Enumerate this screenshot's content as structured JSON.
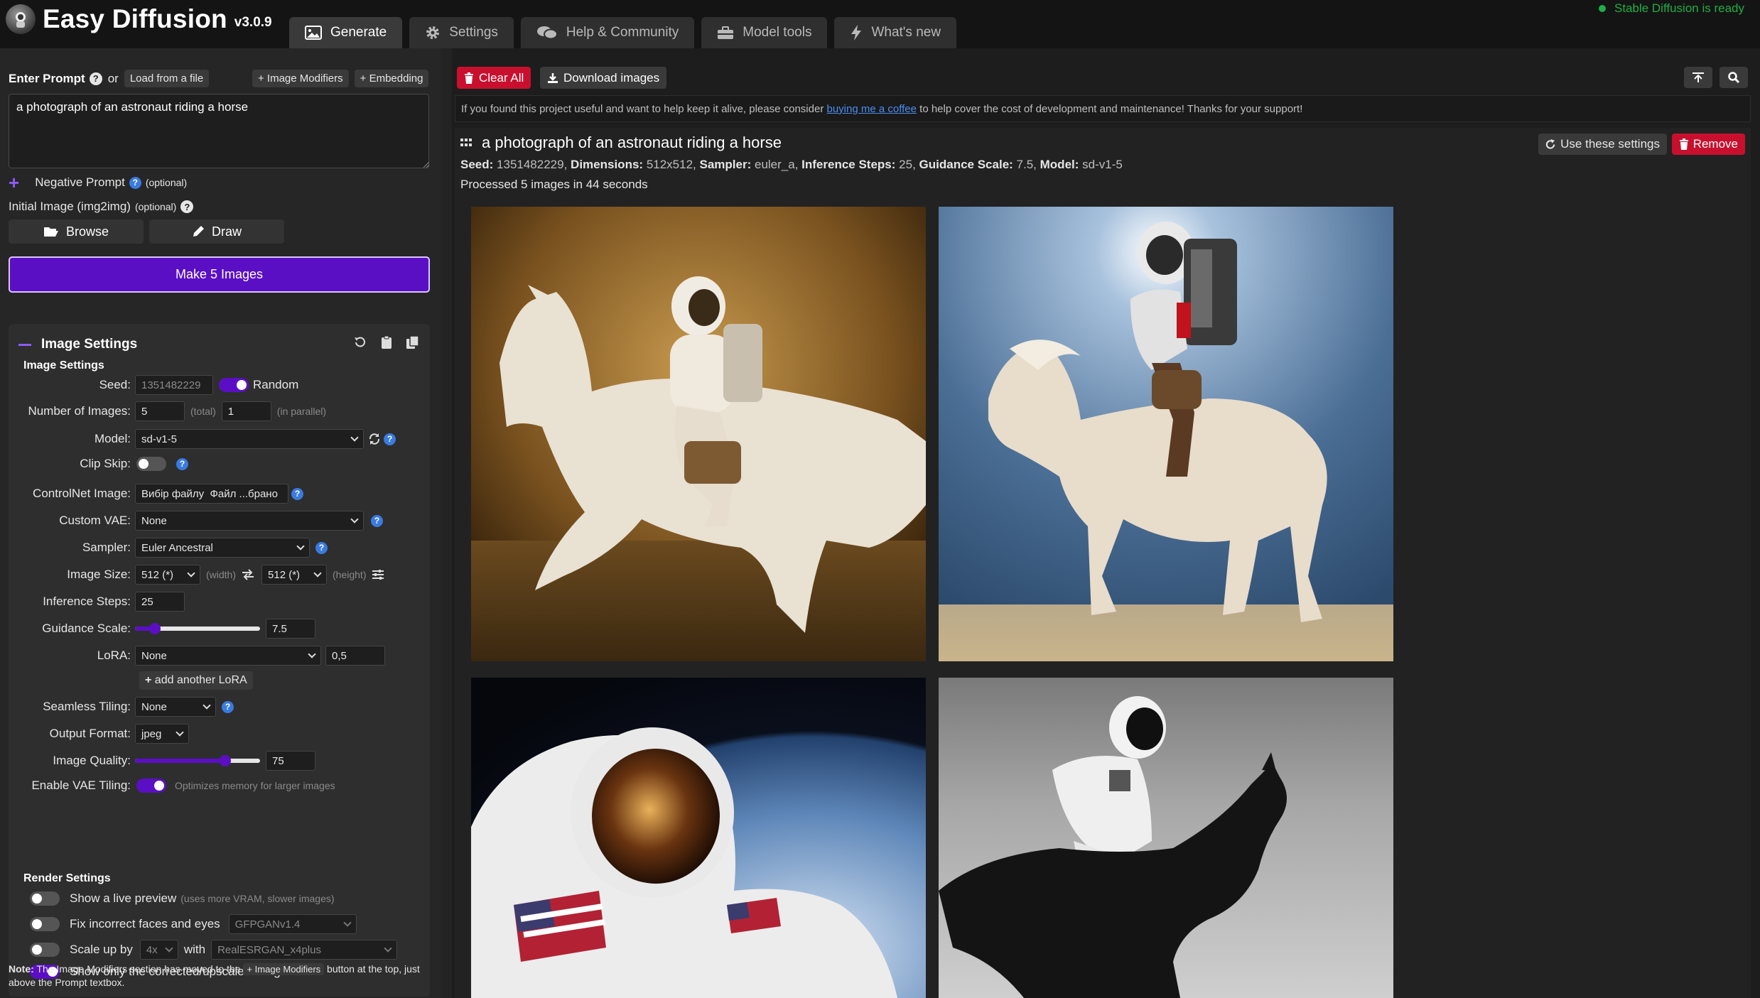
{
  "header": {
    "title": "Easy Diffusion",
    "version": "v3.0.9",
    "status": "Stable Diffusion is ready",
    "tabs": [
      {
        "label": "Generate",
        "icon": "image-icon",
        "active": true
      },
      {
        "label": "Settings",
        "icon": "gear-icon",
        "active": false
      },
      {
        "label": "Help & Community",
        "icon": "comments-icon",
        "active": false
      },
      {
        "label": "Model tools",
        "icon": "toolbox-icon",
        "active": false
      },
      {
        "label": "What's new",
        "icon": "bolt-icon",
        "active": false
      }
    ]
  },
  "prompt": {
    "label": "Enter Prompt",
    "or": "or",
    "load_file": "Load from a file",
    "image_modifiers": "+ Image Modifiers",
    "embedding": "+ Embedding",
    "value": "a photograph of an astronaut riding a horse",
    "negative_label": "Negative Prompt",
    "optional": "(optional)",
    "initial_image_label": "Initial Image (img2img)",
    "browse": "Browse",
    "draw": "Draw",
    "make_button": "Make 5 Images"
  },
  "image_settings": {
    "card_title": "Image Settings",
    "sub_title": "Image Settings",
    "seed_label": "Seed:",
    "seed_value": "1351482229",
    "random_label": "Random",
    "num_images_label": "Number of Images:",
    "num_images": "5",
    "total_hint": "(total)",
    "parallel": "1",
    "parallel_hint": "(in parallel)",
    "model_label": "Model:",
    "model_value": "sd-v1-5",
    "clip_skip_label": "Clip Skip:",
    "controlnet_label": "ControlNet Image:",
    "controlnet_value": "Вибір файлу  Файл ...брано",
    "vae_label": "Custom VAE:",
    "vae_value": "None",
    "sampler_label": "Sampler:",
    "sampler_value": "Euler Ancestral",
    "size_label": "Image Size:",
    "width_value": "512 (*)",
    "width_hint": "(width)",
    "height_value": "512 (*)",
    "height_hint": "(height)",
    "steps_label": "Inference Steps:",
    "steps_value": "25",
    "guidance_label": "Guidance Scale:",
    "guidance_value": "7.5",
    "guidance_fraction": 0.16,
    "lora_label": "LoRA:",
    "lora_value": "None",
    "lora_strength": "0,5",
    "add_lora": "add another LoRA",
    "tiling_label": "Seamless Tiling:",
    "tiling_value": "None",
    "format_label": "Output Format:",
    "format_value": "jpeg",
    "quality_label": "Image Quality:",
    "quality_value": "75",
    "quality_fraction": 0.72,
    "vae_tiling_label": "Enable VAE Tiling:",
    "vae_tiling_hint": "Optimizes memory for larger images"
  },
  "render_settings": {
    "title": "Render Settings",
    "live_preview": "Show a live preview",
    "live_preview_hint": "(uses more VRAM, slower images)",
    "fix_faces": "Fix incorrect faces and eyes",
    "fix_faces_model": "GFPGANv1.4",
    "scale_up": "Scale up by",
    "scale_value": "4x",
    "with": "with",
    "upscaler": "RealESRGAN_x4plus",
    "show_corrected": "Show only the corrected/upscaled image"
  },
  "note": {
    "bold": "Note:",
    "text1": "The Image Modifiers section has moved to the",
    "kbd": "+ Image Modifiers",
    "text2": "button at the top, just above the Prompt textbox."
  },
  "output": {
    "clear_all": "Clear All",
    "download": "Download images",
    "support_pre": "If you found this project useful and want to help keep it alive, please consider",
    "support_link": "buying me a coffee",
    "support_post": "to help cover the cost of development and maintenance! Thanks for your support!",
    "task_title": "a photograph of an astronaut riding a horse",
    "seed_key": "Seed:",
    "seed_val": "1351482229,",
    "dim_key": "Dimensions:",
    "dim_val": "512x512,",
    "sampler_key": "Sampler:",
    "sampler_val": "euler_a,",
    "steps_key": "Inference Steps:",
    "steps_val": "25,",
    "guidance_key": "Guidance Scale:",
    "guidance_val": "7.5,",
    "model_key": "Model:",
    "model_val": "sd-v1-5",
    "processed": "Processed 5 images in 44 seconds",
    "use_settings": "Use these settings",
    "remove": "Remove"
  },
  "colors": {
    "accent": "#5b0fc4",
    "danger": "#c8102e",
    "status": "#1fae45"
  }
}
